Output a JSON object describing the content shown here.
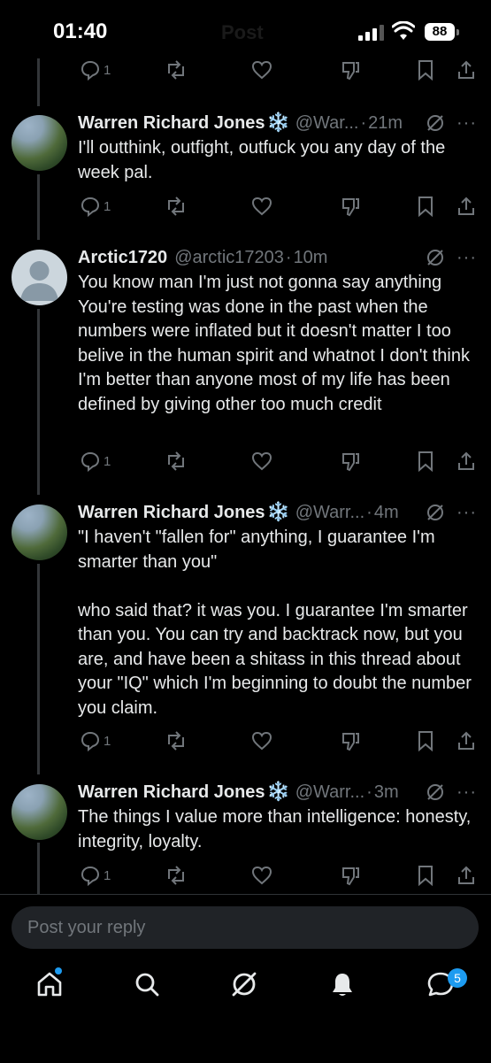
{
  "status_bar": {
    "time": "01:40",
    "battery": "88",
    "header_title": "Post"
  },
  "tweets": [
    {
      "name": "Warren Richard Jones",
      "badge": "❄️",
      "handle": "@War...",
      "time": "21m",
      "text": "I'll outthink, outfight, outfuck you any day of the week pal.",
      "replies": "1"
    },
    {
      "name": "Arctic1720",
      "badge": "",
      "handle": "@arctic17203",
      "time": "10m",
      "text": "You know man I'm just not gonna say anything You're testing was done in the past when the numbers were inflated but it doesn't matter I too belive in the human spirit and whatnot I don't think I'm better than anyone most of my life has been defined by giving other too much credit",
      "replies": "1"
    },
    {
      "name": "Warren Richard Jones",
      "badge": "❄️",
      "handle": "@Warr...",
      "time": "4m",
      "text": "\"I haven't \"fallen for\" anything, I guarantee I'm smarter than you\"\n\nwho said that? it was you. I guarantee I'm smarter than you. You can try and backtrack now, but you are, and have been a shitass in this thread about your \"IQ\" which I'm beginning to doubt the number you claim.",
      "replies": "1"
    },
    {
      "name": "Warren Richard Jones",
      "badge": "❄️",
      "handle": "@Warr...",
      "time": "3m",
      "text": "The things I value more than intelligence: honesty, integrity, loyalty.",
      "replies": "1"
    }
  ],
  "top_action_row": {
    "replies": "1"
  },
  "reply_box": {
    "placeholder": "Post your reply"
  },
  "bottom_nav": {
    "messages_badge": "5"
  },
  "colors": {
    "background": "#000000",
    "text": "#e7e9ea",
    "muted": "#71767b",
    "accent": "#1d9bf0"
  },
  "separator": "·"
}
